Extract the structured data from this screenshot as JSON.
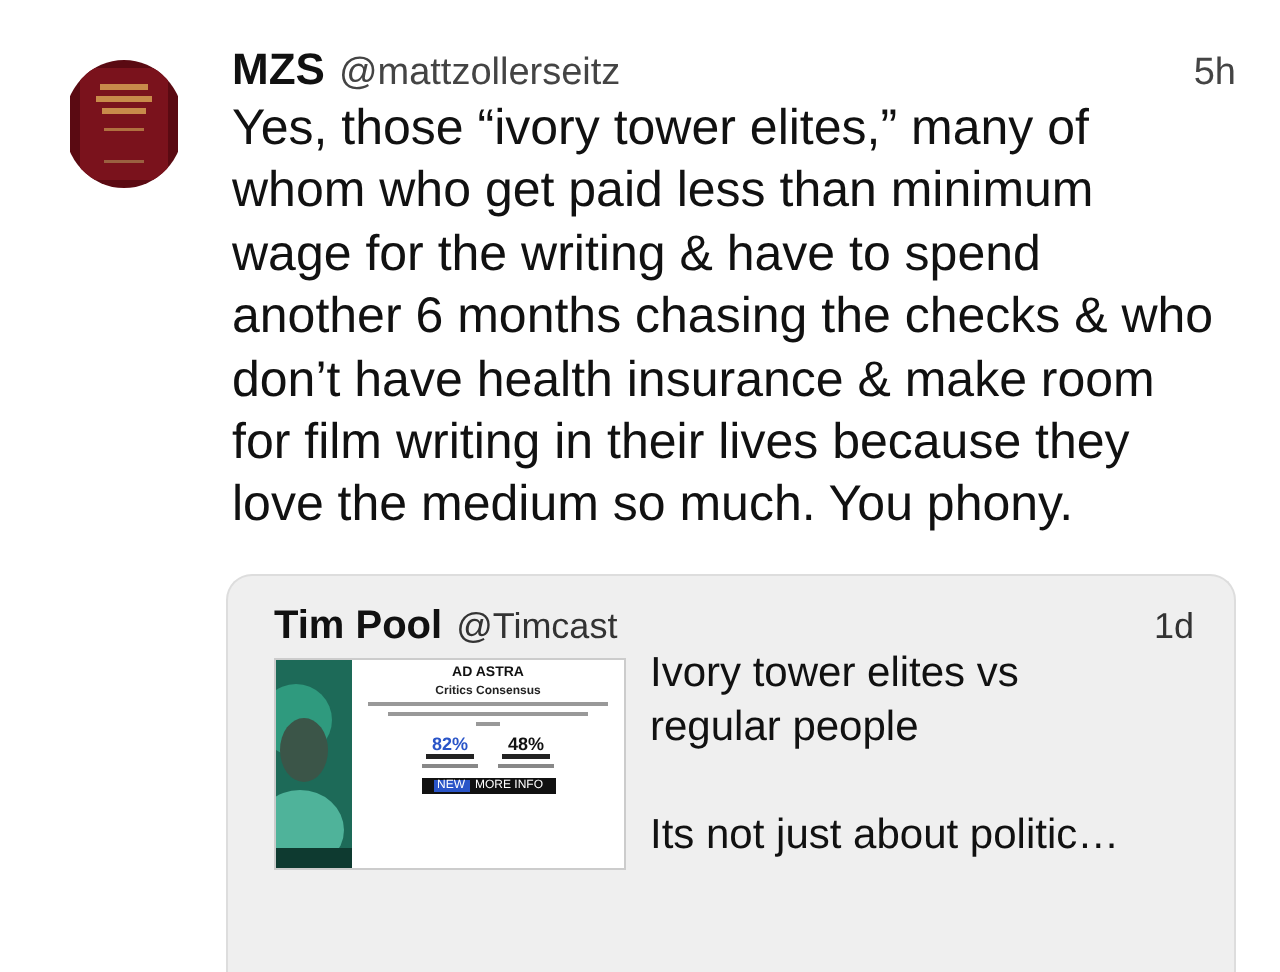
{
  "tweet": {
    "name": "MZS",
    "handle": "@mattzollerseitz",
    "time": "5h",
    "text": "Yes, those “ivory tower elites,” many of whom who get paid less than minimum wage for the writing & have to spend another 6 months chasing the checks & who don’t have health insurance & make room for film writing in their lives because they love the medium so much. You phony.",
    "quoted": {
      "name": "Tim Pool",
      "handle": "@Timcast",
      "time": "1d",
      "text_lines": [
        "Ivory tower elites vs",
        "regular people"
      ],
      "text_tail": "Its not just about politic…",
      "media": {
        "title": "AD ASTRA",
        "subtitle": "Critics Consensus",
        "scores": [
          {
            "value": "82%",
            "color": "#2a55c8"
          },
          {
            "value": "48%",
            "color": "#111111"
          }
        ],
        "badge": "NEW",
        "button": "MORE INFO"
      }
    }
  }
}
